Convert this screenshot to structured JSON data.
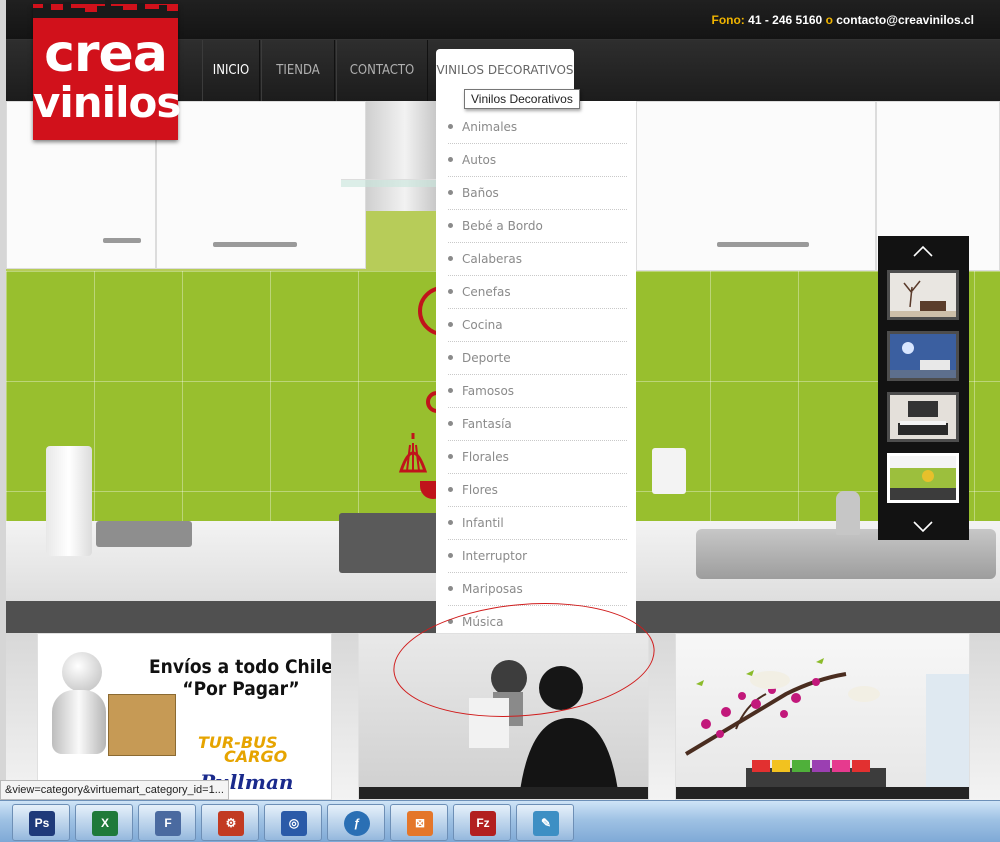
{
  "header": {
    "phone_label": "Fono:",
    "phone_number": "41 - 246 5160",
    "separator": "o",
    "email": "contacto@creavinilos.cl"
  },
  "logo": {
    "line1": "crea",
    "line2": "vinilos"
  },
  "nav": {
    "items": [
      {
        "label": "INICIO",
        "active": true
      },
      {
        "label": "TIENDA",
        "active": false
      },
      {
        "label": "CONTACTO",
        "active": false
      },
      {
        "label": "VINILOS DECORATIVOS",
        "active": false
      }
    ],
    "tooltip": "Vinilos Decorativos"
  },
  "dropdown": {
    "items": [
      "Animales",
      "Autos",
      "Baños",
      "Bebé a Bordo",
      "Calaberas",
      "Cenefas",
      "Cocina",
      "Deporte",
      "Famosos",
      "Fantasía",
      "Florales",
      "Flores",
      "Infantil",
      "Interruptor",
      "Mariposas",
      "Música"
    ]
  },
  "banners": {
    "shipping_line1": "Envíos a todo Chile",
    "shipping_line2": "“Por Pagar”",
    "turbus_line1": "TUR-BUS",
    "turbus_line2": "CARGO",
    "pullman": "Pullman"
  },
  "status_url": "&view=category&virtuemart_category_id=1...",
  "taskbar": {
    "apps": [
      {
        "icon": "photoshop-icon",
        "text": "Ps",
        "color": "#1f3a7a"
      },
      {
        "icon": "excel-icon",
        "text": "X",
        "color": "#1f7a3a"
      },
      {
        "icon": "flash-builder-icon",
        "text": "F",
        "color": "#4a6aa0"
      },
      {
        "icon": "settings-gears-icon",
        "text": "⚙",
        "color": "#c23b22"
      },
      {
        "icon": "dreamweaver-icon",
        "text": "◎",
        "color": "#2a5aa8"
      },
      {
        "icon": "flash-player-icon",
        "text": "ƒ",
        "color": "#2a6fb4"
      },
      {
        "icon": "xampp-icon",
        "text": "⊠",
        "color": "#e4762a"
      },
      {
        "icon": "filezilla-icon",
        "text": "Fz",
        "color": "#b21f1f"
      },
      {
        "icon": "notepad-icon",
        "text": "✎",
        "color": "#3d8fc4"
      }
    ]
  }
}
